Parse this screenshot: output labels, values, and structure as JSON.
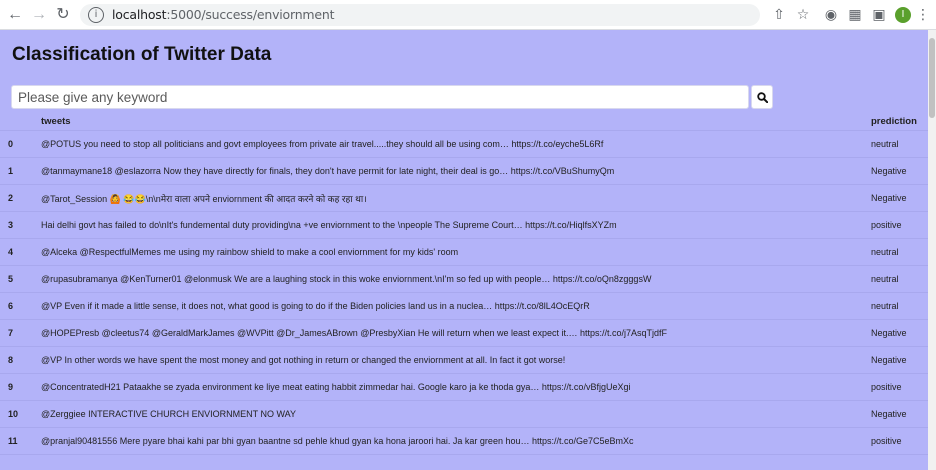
{
  "browser": {
    "url_host": "localhost",
    "url_path": ":5000/success/enviornment",
    "avatar_initial": "I"
  },
  "page": {
    "title": "Classification of Twitter Data",
    "search": {
      "placeholder": "Please give any keyword",
      "value": ""
    },
    "table": {
      "headers": {
        "index": "",
        "tweets": "tweets",
        "prediction": "prediction"
      },
      "rows": [
        {
          "index": "0",
          "tweet": "@POTUS you need to stop all politicians and govt employees from private air travel.....they should all be using com… https://t.co/eyche5L6Rf",
          "prediction": "neutral"
        },
        {
          "index": "1",
          "tweet": "@tanmaymane18 @eslazorra Now they have directly for finals, they don't have permit for late night, their deal is go… https://t.co/VBuShumyQm",
          "prediction": "Negative"
        },
        {
          "index": "2",
          "tweet": "@Tarot_Session 🙆 😂😂\\n\\nमेरा वाला अपने enviornment की आदत करने को कह रहा था।",
          "prediction": "Negative"
        },
        {
          "index": "3",
          "tweet": "Hai delhi govt has failed to do\\nIt's fundemental duty providing\\na +ve enviornment to the \\npeople The Supreme Court… https://t.co/HiqlfsXYZm",
          "prediction": "positive"
        },
        {
          "index": "4",
          "tweet": "@Alceka @RespectfulMemes me using my rainbow shield to make a cool enviornment for my kids' room",
          "prediction": "neutral"
        },
        {
          "index": "5",
          "tweet": "@rupasubramanya @KenTurner01 @elonmusk We are a laughing stock in this woke enviornment.\\nI'm so fed up with people… https://t.co/oQn8zgggsW",
          "prediction": "neutral"
        },
        {
          "index": "6",
          "tweet": "@VP Even if it made a little sense, it does not, what good is going to do if the Biden policies land us in a nuclea… https://t.co/8lL4OcEQrR",
          "prediction": "neutral"
        },
        {
          "index": "7",
          "tweet": "@HOPEPresb @cleetus74 @GeraldMarkJames @WVPitt @Dr_JamesABrown @PresbyXian He will return when we least expect it.… https://t.co/j7AsqTjdfF",
          "prediction": "Negative"
        },
        {
          "index": "8",
          "tweet": "@VP In other words we have spent the most money and got nothing in return or changed the enviornment at all. In fact it got worse!",
          "prediction": "Negative"
        },
        {
          "index": "9",
          "tweet": "@ConcentratedH21 Pataakhe se zyada environment ke liye meat eating habbit zimmedar hai. Google karo ja ke thoda gya… https://t.co/vBfjgUeXgi",
          "prediction": "positive"
        },
        {
          "index": "10",
          "tweet": "@Zerggiee INTERACTIVE CHURCH ENVIORNMENT NO WAY",
          "prediction": "Negative"
        },
        {
          "index": "11",
          "tweet": "@pranjal90481556 Mere pyare bhai kahi par bhi gyan baantne sd pehle khud gyan ka hona jaroori hai. Ja kar green hou… https://t.co/Ge7C5eBmXc",
          "prediction": "positive"
        }
      ]
    }
  },
  "colors": {
    "page_background": "#b3b3f9",
    "row_divider": "#a8a8ee"
  },
  "icons": {
    "back": "arrow-left-icon",
    "forward": "arrow-right-icon",
    "reload": "reload-icon",
    "site_info": "info-icon",
    "search": "magnifier-icon"
  }
}
